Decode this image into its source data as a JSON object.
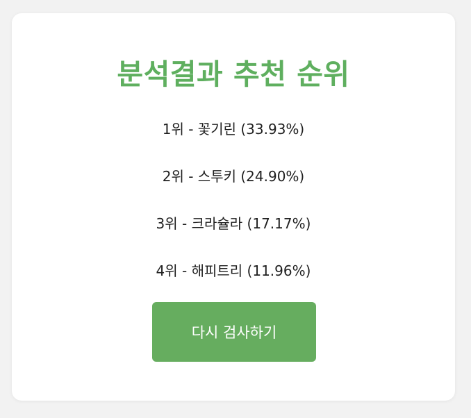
{
  "result": {
    "title": "분석결과 추천 순위",
    "items": [
      "1위 - 꽃기린 (33.93%)",
      "2위 - 스투키 (24.90%)",
      "3위 - 크라슐라 (17.17%)",
      "4위 - 해피트리 (11.96%)"
    ],
    "retry_label": "다시 검사하기"
  },
  "colors": {
    "title": "#5faf5f",
    "button_bg": "#66ad5f",
    "card_bg": "#ffffff",
    "page_bg": "#f2f2f2"
  }
}
